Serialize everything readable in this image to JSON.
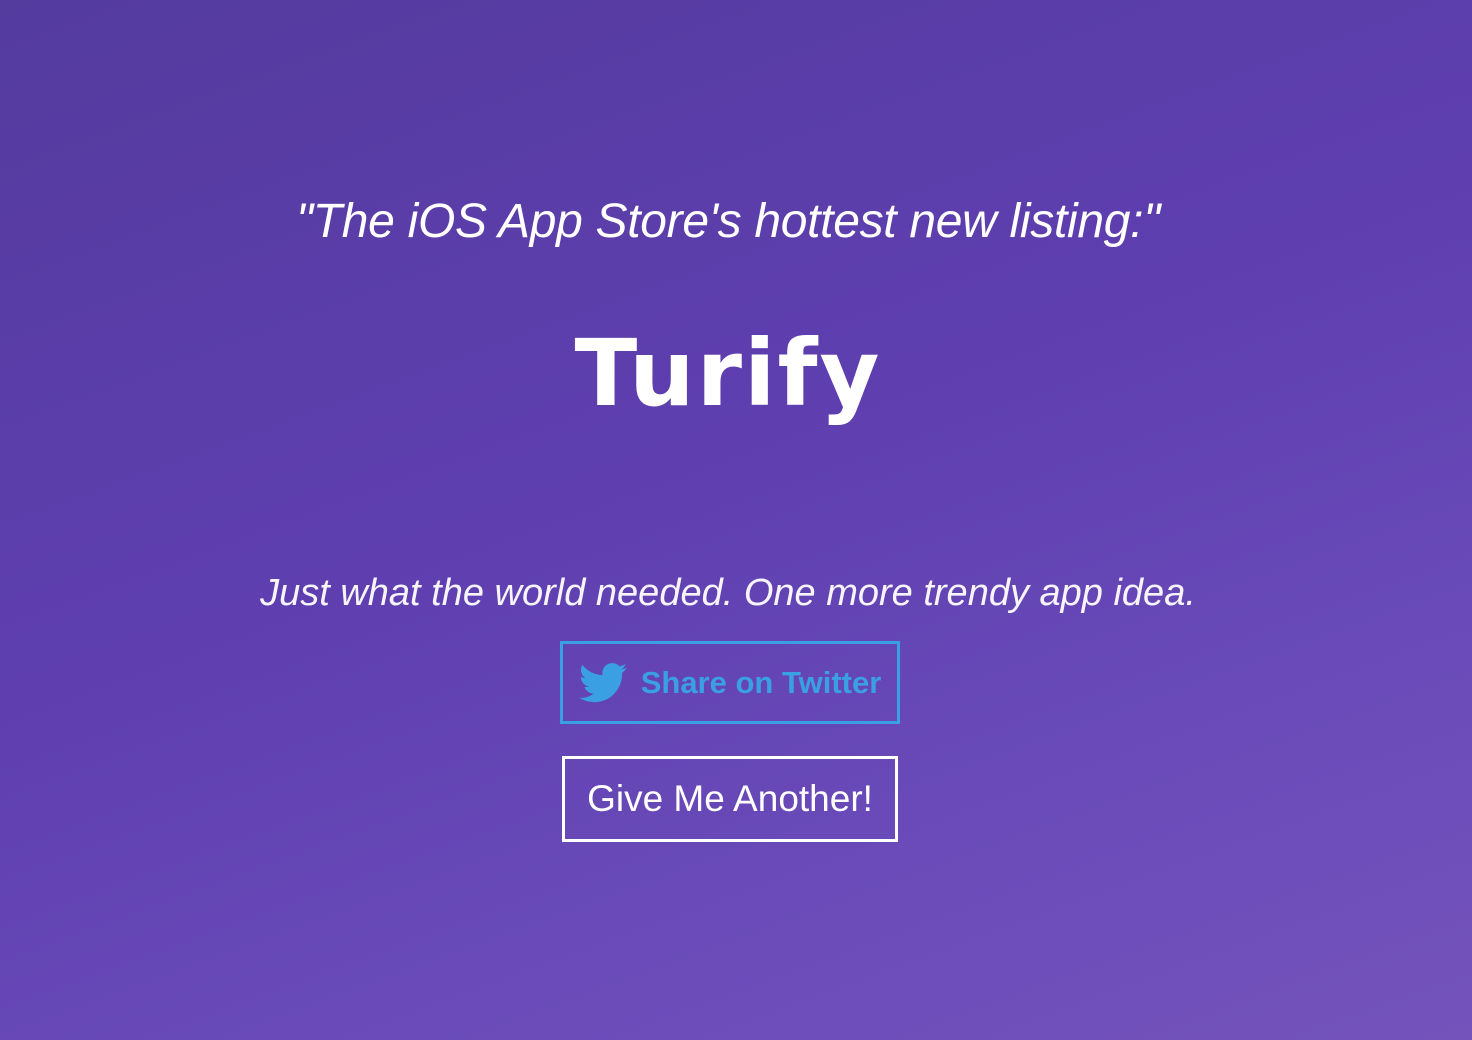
{
  "headline": "\"The iOS App Store's hottest new listing:\"",
  "app_name": "Turify",
  "tagline": "Just what the world needed. One more trendy app idea.",
  "share_button": {
    "label": "Share on Twitter",
    "icon": "twitter-bird-icon",
    "color": "#3aa0e3"
  },
  "another_button": {
    "label": "Give Me Another!"
  },
  "colors": {
    "background_start": "#543b9e",
    "background_end": "#7453bb",
    "text": "#ffffff"
  }
}
